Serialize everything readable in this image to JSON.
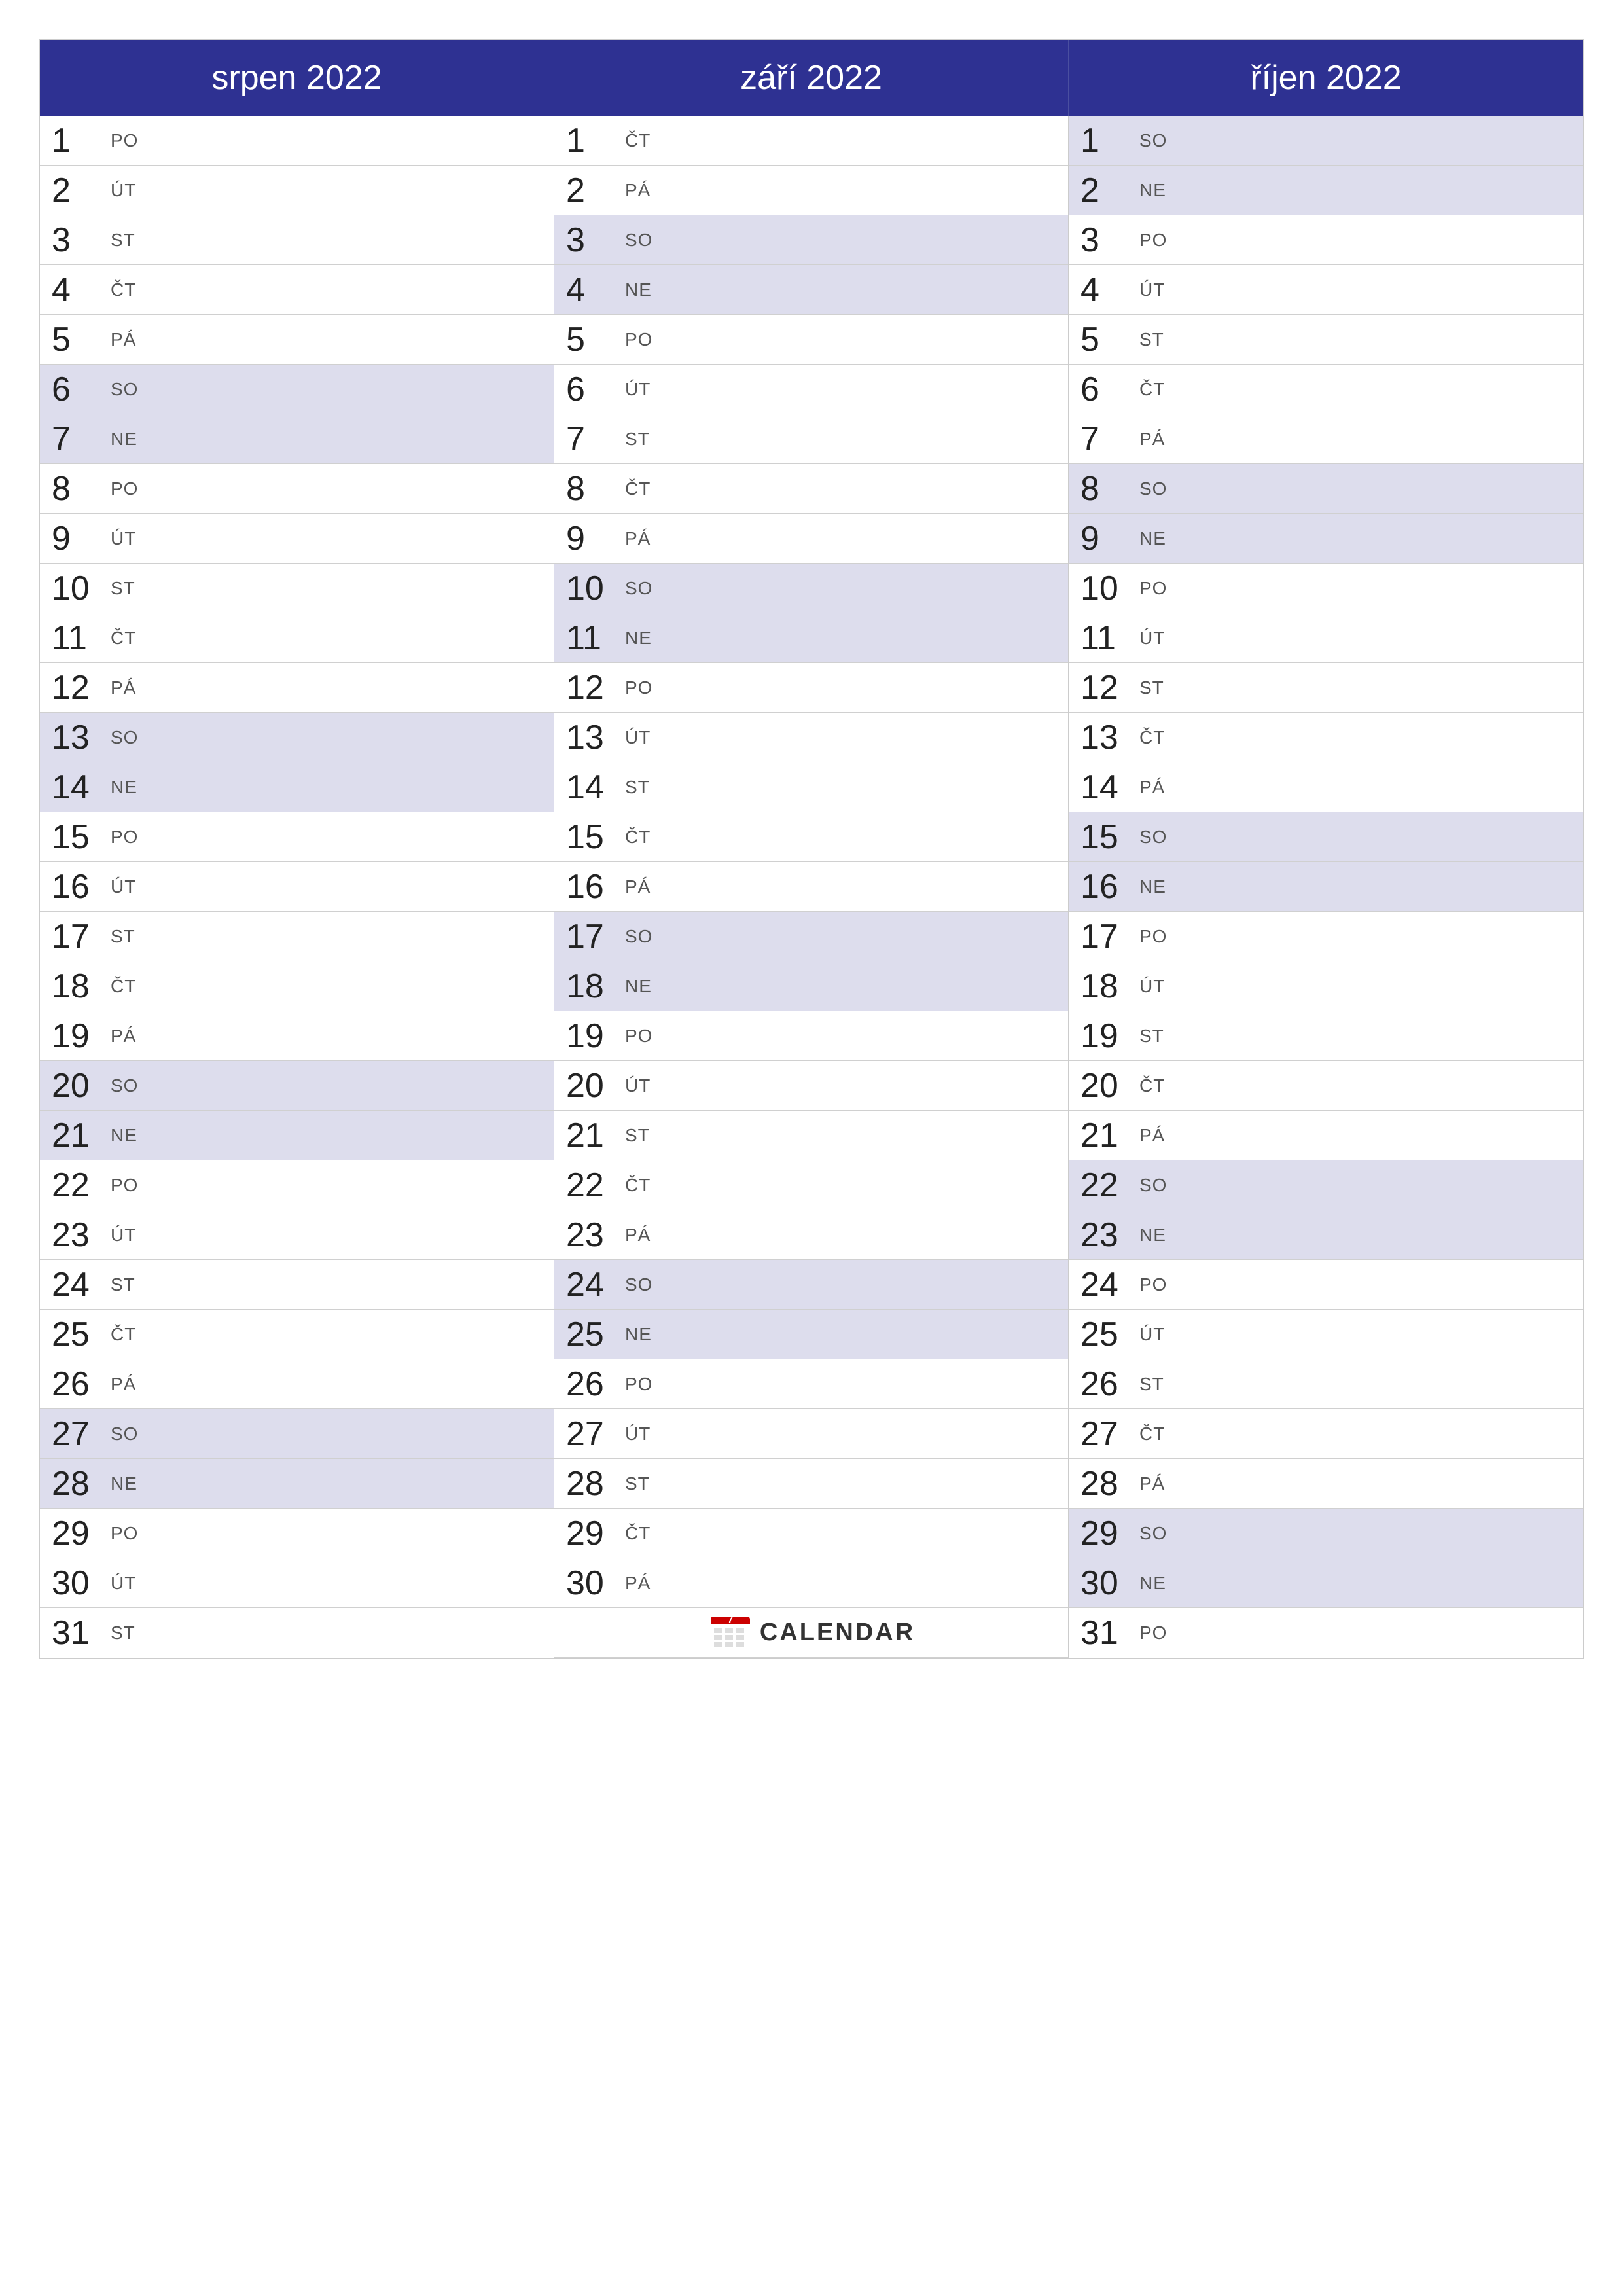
{
  "months": [
    {
      "name": "srpen 2022",
      "days": [
        {
          "num": "1",
          "dayName": "PO",
          "weekend": false
        },
        {
          "num": "2",
          "dayName": "ÚT",
          "weekend": false
        },
        {
          "num": "3",
          "dayName": "ST",
          "weekend": false
        },
        {
          "num": "4",
          "dayName": "ČT",
          "weekend": false
        },
        {
          "num": "5",
          "dayName": "PÁ",
          "weekend": false
        },
        {
          "num": "6",
          "dayName": "SO",
          "weekend": true
        },
        {
          "num": "7",
          "dayName": "NE",
          "weekend": true
        },
        {
          "num": "8",
          "dayName": "PO",
          "weekend": false
        },
        {
          "num": "9",
          "dayName": "ÚT",
          "weekend": false
        },
        {
          "num": "10",
          "dayName": "ST",
          "weekend": false
        },
        {
          "num": "11",
          "dayName": "ČT",
          "weekend": false
        },
        {
          "num": "12",
          "dayName": "PÁ",
          "weekend": false
        },
        {
          "num": "13",
          "dayName": "SO",
          "weekend": true
        },
        {
          "num": "14",
          "dayName": "NE",
          "weekend": true
        },
        {
          "num": "15",
          "dayName": "PO",
          "weekend": false
        },
        {
          "num": "16",
          "dayName": "ÚT",
          "weekend": false
        },
        {
          "num": "17",
          "dayName": "ST",
          "weekend": false
        },
        {
          "num": "18",
          "dayName": "ČT",
          "weekend": false
        },
        {
          "num": "19",
          "dayName": "PÁ",
          "weekend": false
        },
        {
          "num": "20",
          "dayName": "SO",
          "weekend": true
        },
        {
          "num": "21",
          "dayName": "NE",
          "weekend": true
        },
        {
          "num": "22",
          "dayName": "PO",
          "weekend": false
        },
        {
          "num": "23",
          "dayName": "ÚT",
          "weekend": false
        },
        {
          "num": "24",
          "dayName": "ST",
          "weekend": false
        },
        {
          "num": "25",
          "dayName": "ČT",
          "weekend": false
        },
        {
          "num": "26",
          "dayName": "PÁ",
          "weekend": false
        },
        {
          "num": "27",
          "dayName": "SO",
          "weekend": true
        },
        {
          "num": "28",
          "dayName": "NE",
          "weekend": true
        },
        {
          "num": "29",
          "dayName": "PO",
          "weekend": false
        },
        {
          "num": "30",
          "dayName": "ÚT",
          "weekend": false
        },
        {
          "num": "31",
          "dayName": "ST",
          "weekend": false
        }
      ]
    },
    {
      "name": "září 2022",
      "days": [
        {
          "num": "1",
          "dayName": "ČT",
          "weekend": false
        },
        {
          "num": "2",
          "dayName": "PÁ",
          "weekend": false
        },
        {
          "num": "3",
          "dayName": "SO",
          "weekend": true
        },
        {
          "num": "4",
          "dayName": "NE",
          "weekend": true
        },
        {
          "num": "5",
          "dayName": "PO",
          "weekend": false
        },
        {
          "num": "6",
          "dayName": "ÚT",
          "weekend": false
        },
        {
          "num": "7",
          "dayName": "ST",
          "weekend": false
        },
        {
          "num": "8",
          "dayName": "ČT",
          "weekend": false
        },
        {
          "num": "9",
          "dayName": "PÁ",
          "weekend": false
        },
        {
          "num": "10",
          "dayName": "SO",
          "weekend": true
        },
        {
          "num": "11",
          "dayName": "NE",
          "weekend": true
        },
        {
          "num": "12",
          "dayName": "PO",
          "weekend": false
        },
        {
          "num": "13",
          "dayName": "ÚT",
          "weekend": false
        },
        {
          "num": "14",
          "dayName": "ST",
          "weekend": false
        },
        {
          "num": "15",
          "dayName": "ČT",
          "weekend": false
        },
        {
          "num": "16",
          "dayName": "PÁ",
          "weekend": false
        },
        {
          "num": "17",
          "dayName": "SO",
          "weekend": true
        },
        {
          "num": "18",
          "dayName": "NE",
          "weekend": true
        },
        {
          "num": "19",
          "dayName": "PO",
          "weekend": false
        },
        {
          "num": "20",
          "dayName": "ÚT",
          "weekend": false
        },
        {
          "num": "21",
          "dayName": "ST",
          "weekend": false
        },
        {
          "num": "22",
          "dayName": "ČT",
          "weekend": false
        },
        {
          "num": "23",
          "dayName": "PÁ",
          "weekend": false
        },
        {
          "num": "24",
          "dayName": "SO",
          "weekend": true
        },
        {
          "num": "25",
          "dayName": "NE",
          "weekend": true
        },
        {
          "num": "26",
          "dayName": "PO",
          "weekend": false
        },
        {
          "num": "27",
          "dayName": "ÚT",
          "weekend": false
        },
        {
          "num": "28",
          "dayName": "ST",
          "weekend": false
        },
        {
          "num": "29",
          "dayName": "ČT",
          "weekend": false
        },
        {
          "num": "30",
          "dayName": "PÁ",
          "weekend": false
        }
      ]
    },
    {
      "name": "říjen 2022",
      "days": [
        {
          "num": "1",
          "dayName": "SO",
          "weekend": true
        },
        {
          "num": "2",
          "dayName": "NE",
          "weekend": true
        },
        {
          "num": "3",
          "dayName": "PO",
          "weekend": false
        },
        {
          "num": "4",
          "dayName": "ÚT",
          "weekend": false
        },
        {
          "num": "5",
          "dayName": "ST",
          "weekend": false
        },
        {
          "num": "6",
          "dayName": "ČT",
          "weekend": false
        },
        {
          "num": "7",
          "dayName": "PÁ",
          "weekend": false
        },
        {
          "num": "8",
          "dayName": "SO",
          "weekend": true
        },
        {
          "num": "9",
          "dayName": "NE",
          "weekend": true
        },
        {
          "num": "10",
          "dayName": "PO",
          "weekend": false
        },
        {
          "num": "11",
          "dayName": "ÚT",
          "weekend": false
        },
        {
          "num": "12",
          "dayName": "ST",
          "weekend": false
        },
        {
          "num": "13",
          "dayName": "ČT",
          "weekend": false
        },
        {
          "num": "14",
          "dayName": "PÁ",
          "weekend": false
        },
        {
          "num": "15",
          "dayName": "SO",
          "weekend": true
        },
        {
          "num": "16",
          "dayName": "NE",
          "weekend": true
        },
        {
          "num": "17",
          "dayName": "PO",
          "weekend": false
        },
        {
          "num": "18",
          "dayName": "ÚT",
          "weekend": false
        },
        {
          "num": "19",
          "dayName": "ST",
          "weekend": false
        },
        {
          "num": "20",
          "dayName": "ČT",
          "weekend": false
        },
        {
          "num": "21",
          "dayName": "PÁ",
          "weekend": false
        },
        {
          "num": "22",
          "dayName": "SO",
          "weekend": true
        },
        {
          "num": "23",
          "dayName": "NE",
          "weekend": true
        },
        {
          "num": "24",
          "dayName": "PO",
          "weekend": false
        },
        {
          "num": "25",
          "dayName": "ÚT",
          "weekend": false
        },
        {
          "num": "26",
          "dayName": "ST",
          "weekend": false
        },
        {
          "num": "27",
          "dayName": "ČT",
          "weekend": false
        },
        {
          "num": "28",
          "dayName": "PÁ",
          "weekend": false
        },
        {
          "num": "29",
          "dayName": "SO",
          "weekend": true
        },
        {
          "num": "30",
          "dayName": "NE",
          "weekend": true
        },
        {
          "num": "31",
          "dayName": "PO",
          "weekend": false
        }
      ]
    }
  ],
  "logo": {
    "text": "CALENDAR",
    "icon_color": "#cc0000"
  }
}
